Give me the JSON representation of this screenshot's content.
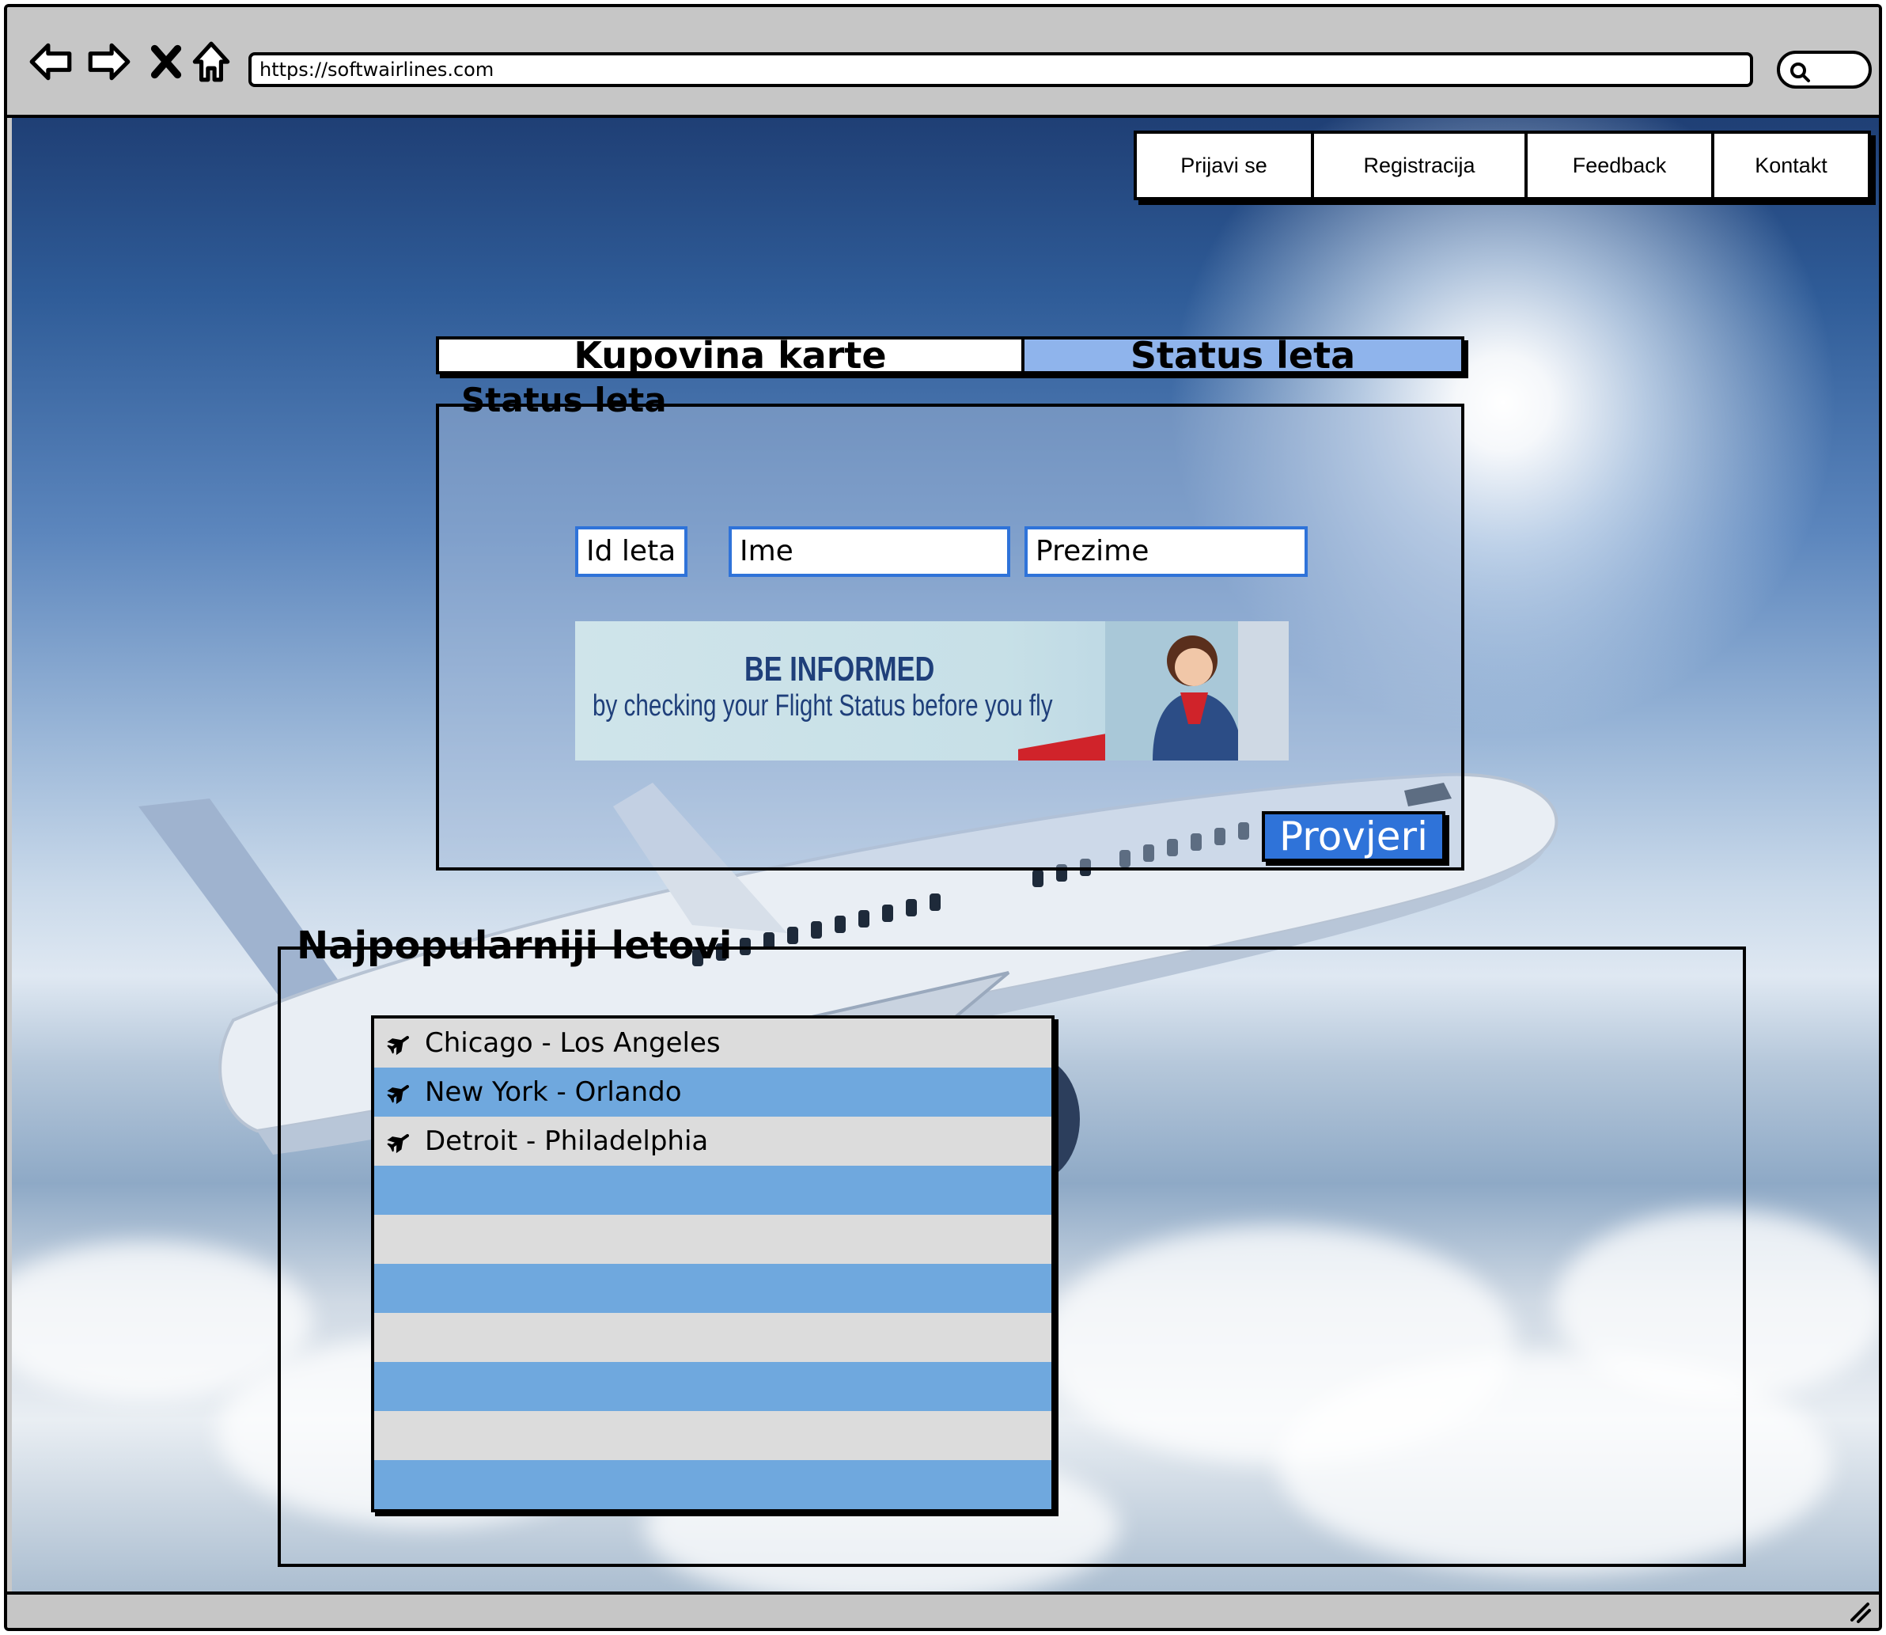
{
  "browser": {
    "url": "https://softwairlines.com",
    "icons": [
      "back-arrow-icon",
      "forward-arrow-icon",
      "close-icon",
      "home-icon",
      "search-icon"
    ]
  },
  "nav": {
    "items": [
      {
        "label": "Prijavi se"
      },
      {
        "label": "Registracija"
      },
      {
        "label": "Feedback"
      },
      {
        "label": "Kontakt"
      }
    ]
  },
  "tabs": [
    {
      "label": "Kupovina karte",
      "selected": false
    },
    {
      "label": "Status leta",
      "selected": true
    }
  ],
  "status_panel": {
    "title": "Status leta",
    "fields": {
      "flight_id": "Id leta",
      "first_name": "Ime",
      "last_name": "Prezime"
    },
    "banner": {
      "title": "BE INFORMED",
      "subtitle": "by checking your Flight Status before you fly"
    },
    "check_button": "Provjeri"
  },
  "popular": {
    "title": "Najpopularniji letovi",
    "flights": [
      "Chicago - Los Angeles",
      "New York - Orlando",
      "Detroit - Philadelphia",
      "",
      "",
      "",
      "",
      "",
      "",
      ""
    ]
  },
  "colors": {
    "accent_blue": "#2f73d9",
    "tab_selected": "#8fb4ec",
    "row_blue": "#6fa8de",
    "row_gray": "#dcdcdc",
    "banner_text": "#1f3f7a"
  }
}
